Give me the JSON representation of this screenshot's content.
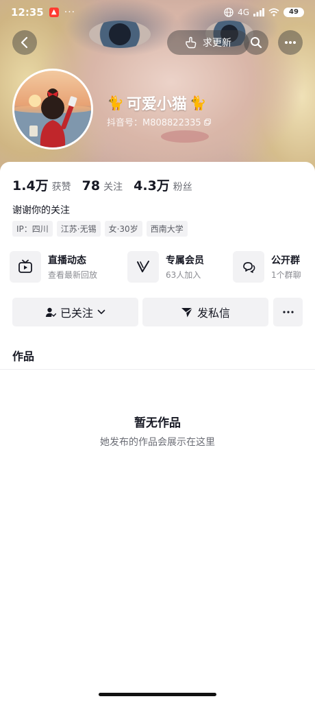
{
  "status_bar": {
    "time": "12:35",
    "app_badge": "",
    "dots": "···",
    "network": "4G",
    "battery": "49"
  },
  "nav": {
    "update_label": "求更新"
  },
  "profile": {
    "name": "可爱小猫",
    "douyin_id": "抖音号：M808822335"
  },
  "stats": [
    {
      "value": "1.4万",
      "label": "获赞"
    },
    {
      "value": "78",
      "label": "关注"
    },
    {
      "value": "4.3万",
      "label": "粉丝"
    }
  ],
  "bio": "谢谢你的关注",
  "tags": [
    "IP：四川",
    "江苏·无锡",
    "女·30岁",
    "西南大学"
  ],
  "features": [
    {
      "title": "直播动态",
      "sub": "查看最新回放",
      "icon": "tv-icon"
    },
    {
      "title": "专属会员",
      "sub": "63人加入",
      "icon": "v-icon"
    },
    {
      "title": "公开群",
      "sub": "1个群聊",
      "icon": "chat-icon"
    }
  ],
  "actions": {
    "followed_label": "已关注",
    "message_label": "发私信"
  },
  "works": {
    "title": "作品",
    "empty_title": "暂无作品",
    "empty_sub": "她发布的作品会展示在这里"
  },
  "colors": {
    "text_primary": "#161823",
    "text_secondary": "#6b6d75",
    "button_bg": "#f2f2f4"
  }
}
